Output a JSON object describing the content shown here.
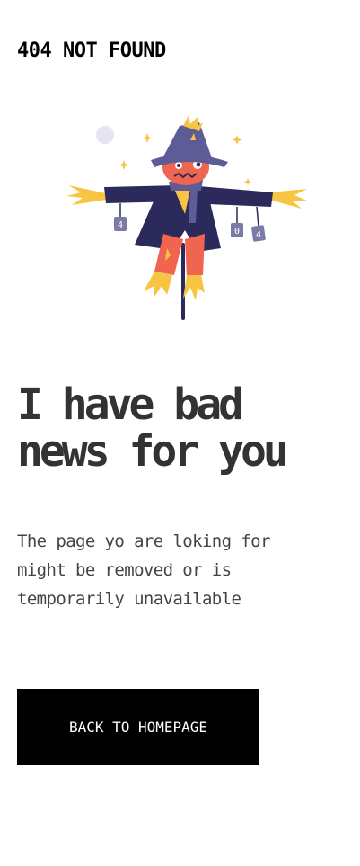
{
  "header": {
    "label": "404 NOT FOUND"
  },
  "illustration": {
    "name": "scarecrow-icon",
    "can_labels": [
      "4",
      "0",
      "4"
    ],
    "colors": {
      "hat": "#2b2a5a",
      "face": "#f0654f",
      "coat": "#2b2a5a",
      "pants": "#f0654f",
      "straw": "#f7c543",
      "scarf": "#5d5c97",
      "moon": "#e4e4f2",
      "sparkle": "#f7c543"
    }
  },
  "main": {
    "headline_lines": [
      "I have bad",
      "news for you"
    ],
    "body_lines": [
      "The page yo are loking for",
      "might be removed or is",
      "temporarily unavailable"
    ]
  },
  "actions": {
    "home_label": "BACK TO HOMEPAGE"
  },
  "colors": {
    "button_bg": "#000000",
    "button_text": "#ffffff",
    "text": "#333333"
  }
}
